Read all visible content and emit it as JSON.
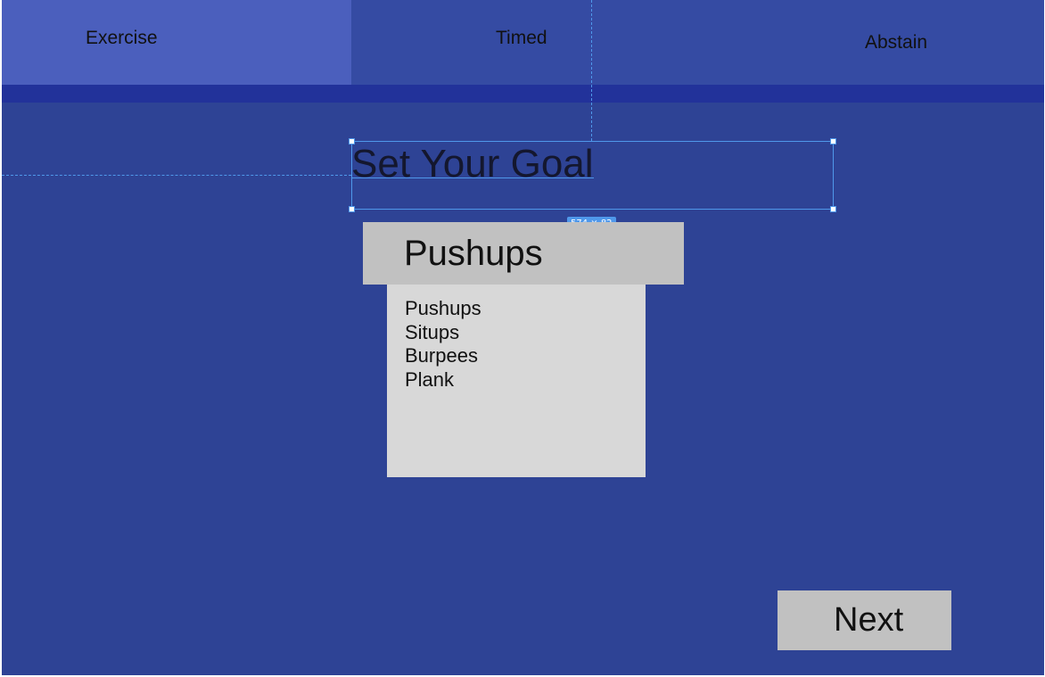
{
  "tabs": [
    {
      "label": "Exercise",
      "active": true
    },
    {
      "label": "Timed",
      "active": false
    },
    {
      "label": "Abstain",
      "active": false
    }
  ],
  "main": {
    "title": "Set Your Goal",
    "selection_size_label": "574 × 82"
  },
  "dropdown": {
    "selected": "Pushups",
    "options": [
      "Pushups",
      "Situps",
      "Burpees",
      "Plank"
    ]
  },
  "next_label": "Next",
  "colors": {
    "background": "#2e4395",
    "tabbar": "#354ba3",
    "active_tab": "#4b5fbd",
    "indicator_bar": "#22329a",
    "dropdown_header": "#c1c1c1",
    "dropdown_list": "#d8d8d8",
    "selection": "#4f98ea"
  }
}
